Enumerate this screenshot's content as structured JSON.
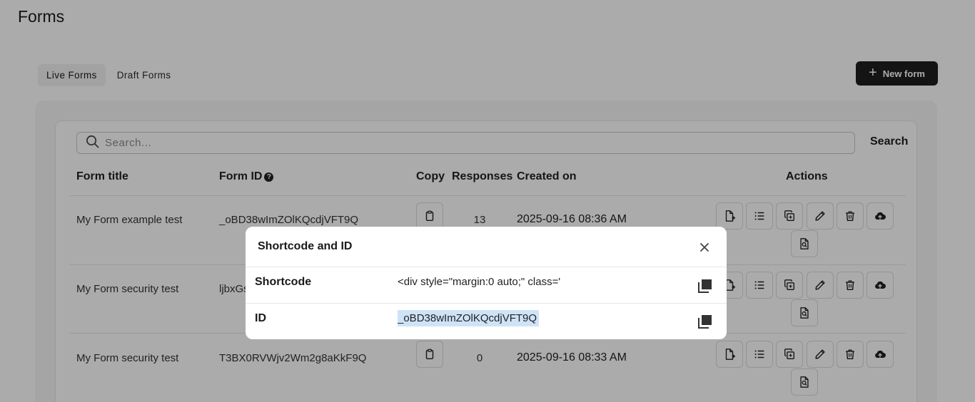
{
  "page": {
    "title": "Forms"
  },
  "tabs": [
    {
      "label": "Live Forms",
      "active": true
    },
    {
      "label": "Draft Forms",
      "active": false
    }
  ],
  "new_form_button": {
    "label": "New form",
    "icon": "plus-icon"
  },
  "search": {
    "placeholder": "Search...",
    "button_label": "Search"
  },
  "table": {
    "headers": {
      "title": "Form title",
      "id": "Form ID",
      "copy": "Copy",
      "responses": "Responses",
      "created": "Created on",
      "actions": "Actions"
    },
    "rows": [
      {
        "title": "My Form example test",
        "id": "_oBD38wImZOlKQcdjVFT9Q",
        "responses": "13",
        "created": "2025-09-16 08:36 AM"
      },
      {
        "title": "My Form security test",
        "id": "ljbxGs",
        "responses": "",
        "created": ""
      },
      {
        "title": "My Form security test",
        "id": "T3BX0RVWjv2Wm2g8aKkF9Q",
        "responses": "0",
        "created": "2025-09-16 08:33 AM"
      }
    ],
    "action_icons": [
      "file-plus-icon",
      "list-icon",
      "duplicate-icon",
      "pencil-icon",
      "trash-icon",
      "cloud-upload-icon",
      "file-search-icon"
    ]
  },
  "modal": {
    "title": "Shortcode and ID",
    "shortcode_label": "Shortcode",
    "shortcode_value": "<div style=\"margin:0 auto;\" class=\"|",
    "id_label": "ID",
    "id_value": "_oBD38wImZOlKQcdjVFT9Q"
  },
  "colors": {
    "primary_button": "#1f1f1f",
    "selection": "#cfe3f7",
    "overlay": "rgba(0,0,0,0.33)"
  }
}
